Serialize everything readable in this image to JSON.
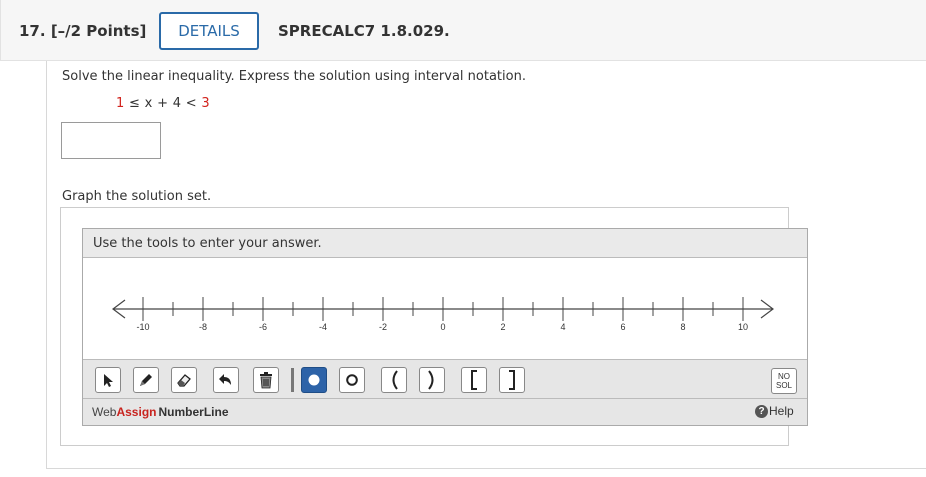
{
  "header": {
    "question_number": "17.",
    "points": "[–/2 Points]",
    "details_label": "DETAILS",
    "course_code": "SPRECALC7 1.8.029."
  },
  "question": {
    "prompt": "Solve the linear inequality. Express the solution using interval notation.",
    "inequality": {
      "left": "1",
      "op1": "≤",
      "middle": "x + 4",
      "op2": "<",
      "right": "3"
    },
    "answer_value": "",
    "graph_prompt": "Graph the solution set."
  },
  "number_line": {
    "title": "Use the tools to enter your answer.",
    "min": -11,
    "max": 11,
    "tick_step": 1,
    "labels": [
      "-10",
      "-8",
      "-6",
      "-4",
      "-2",
      "0",
      "2",
      "4",
      "6",
      "8",
      "10"
    ],
    "label_values": [
      -10,
      -8,
      -6,
      -4,
      -2,
      0,
      2,
      4,
      6,
      8,
      10
    ],
    "major_values": [
      -10,
      -8,
      -6,
      -4,
      -2,
      0,
      2,
      4,
      6,
      8,
      10
    ]
  },
  "toolbar": {
    "tools": [
      {
        "name": "pointer-tool",
        "icon": "arrow-pointer-icon",
        "active": false
      },
      {
        "name": "pencil-tool",
        "icon": "pencil-icon",
        "active": false
      },
      {
        "name": "eraser-tool",
        "icon": "eraser-icon",
        "active": false
      },
      {
        "name": "undo-tool",
        "icon": "undo-icon",
        "active": false
      },
      {
        "name": "delete-tool",
        "icon": "trash-icon",
        "active": false
      },
      {
        "name": "closed-point-tool",
        "icon": "filled-circle-icon",
        "active": true
      },
      {
        "name": "open-point-tool",
        "icon": "open-circle-icon",
        "active": false
      },
      {
        "name": "left-paren-tool",
        "symbol": "(",
        "active": false
      },
      {
        "name": "right-paren-tool",
        "symbol": ")",
        "active": false
      },
      {
        "name": "left-bracket-tool",
        "symbol": "[",
        "active": false
      },
      {
        "name": "right-bracket-tool",
        "symbol": "]",
        "active": false
      }
    ],
    "no_solution_line1": "NO",
    "no_solution_line2": "SOL"
  },
  "footer": {
    "brand_web": "Web",
    "brand_assign": "Assign",
    "brand_product": "NumberLine",
    "help_label": "Help"
  },
  "colors": {
    "accent": "#2a6aa8",
    "red": "#d2231d",
    "active_tool": "#2d63a8"
  }
}
